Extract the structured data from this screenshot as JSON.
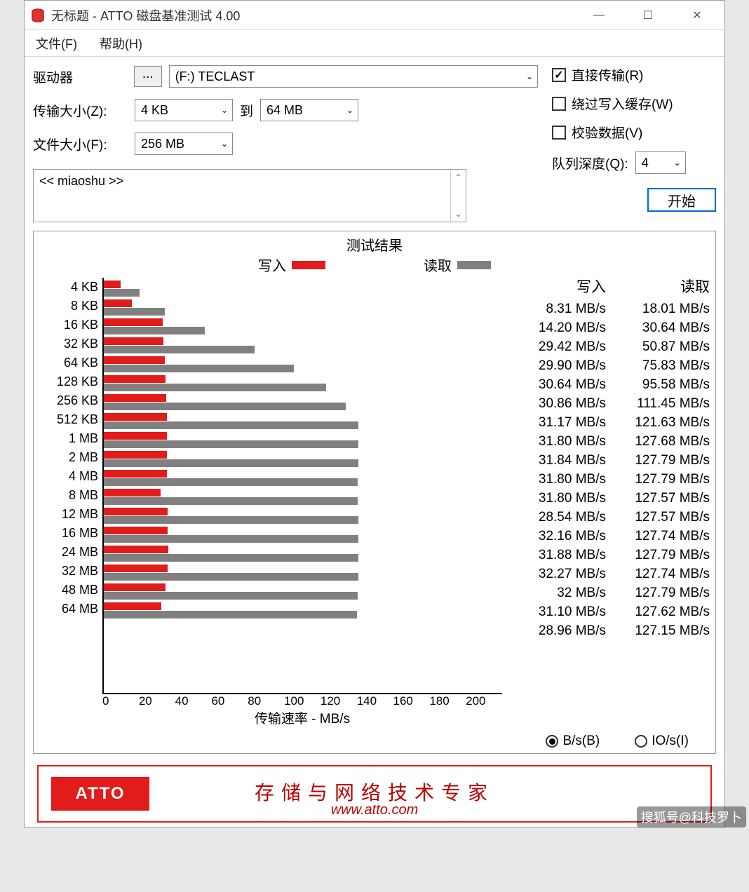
{
  "window": {
    "title": "无标题 - ATTO 磁盘基准测试 4.00"
  },
  "menu": {
    "file": "文件(F)",
    "help": "帮助(H)"
  },
  "config": {
    "drive_label": "驱动器",
    "drive_btn": "...",
    "drive_value": "(F:) TECLAST",
    "transfer_label": "传输大小(Z):",
    "transfer_from": "4 KB",
    "transfer_to_label": "到",
    "transfer_to": "64 MB",
    "file_label": "文件大小(F):",
    "file_value": "256 MB",
    "direct_io": "直接传输(R)",
    "bypass_cache": "绕过写入缓存(W)",
    "verify_data": "校验数据(V)",
    "queue_depth_label": "队列深度(Q):",
    "queue_depth_value": "4",
    "desc_text": "<< miaoshu >>",
    "start_btn": "开始"
  },
  "chart_data": {
    "type": "bar",
    "title": "测试结果",
    "legend": {
      "write": "写入",
      "read": "读取"
    },
    "xlabel": "传输速率 - MB/s",
    "xlim": [
      0,
      200
    ],
    "xticks": [
      "0",
      "20",
      "40",
      "60",
      "80",
      "100",
      "120",
      "140",
      "160",
      "180",
      "200"
    ],
    "categories": [
      "4 KB",
      "8 KB",
      "16 KB",
      "32 KB",
      "64 KB",
      "128 KB",
      "256 KB",
      "512 KB",
      "1 MB",
      "2 MB",
      "4 MB",
      "8 MB",
      "12 MB",
      "16 MB",
      "24 MB",
      "32 MB",
      "48 MB",
      "64 MB"
    ],
    "series": [
      {
        "name": "写入",
        "values": [
          8.31,
          14.2,
          29.42,
          29.9,
          30.64,
          30.86,
          31.17,
          31.8,
          31.84,
          31.8,
          31.8,
          28.54,
          32.16,
          31.88,
          32.27,
          32.0,
          31.1,
          28.96
        ]
      },
      {
        "name": "读取",
        "values": [
          18.01,
          30.64,
          50.87,
          75.83,
          95.58,
          111.45,
          121.63,
          127.68,
          127.79,
          127.79,
          127.57,
          127.57,
          127.74,
          127.79,
          127.74,
          127.79,
          127.62,
          127.15
        ]
      }
    ],
    "unit": "MB/s"
  },
  "results": {
    "write_head": "写入",
    "read_head": "读取",
    "write": [
      "8.31 MB/s",
      "14.20 MB/s",
      "29.42 MB/s",
      "29.90 MB/s",
      "30.64 MB/s",
      "30.86 MB/s",
      "31.17 MB/s",
      "31.80 MB/s",
      "31.84 MB/s",
      "31.80 MB/s",
      "31.80 MB/s",
      "28.54 MB/s",
      "32.16 MB/s",
      "31.88 MB/s",
      "32.27 MB/s",
      "32 MB/s",
      "31.10 MB/s",
      "28.96 MB/s"
    ],
    "read": [
      "18.01 MB/s",
      "30.64 MB/s",
      "50.87 MB/s",
      "75.83 MB/s",
      "95.58 MB/s",
      "111.45 MB/s",
      "121.63 MB/s",
      "127.68 MB/s",
      "127.79 MB/s",
      "127.79 MB/s",
      "127.57 MB/s",
      "127.57 MB/s",
      "127.74 MB/s",
      "127.79 MB/s",
      "127.74 MB/s",
      "127.79 MB/s",
      "127.62 MB/s",
      "127.15 MB/s"
    ]
  },
  "radio": {
    "bs": "B/s(B)",
    "ios": "IO/s(I)"
  },
  "footer": {
    "slogan": "存储与网络技术专家",
    "url": "www.atto.com",
    "logo": "ATTO"
  },
  "watermark": "搜狐号@科技罗卜"
}
